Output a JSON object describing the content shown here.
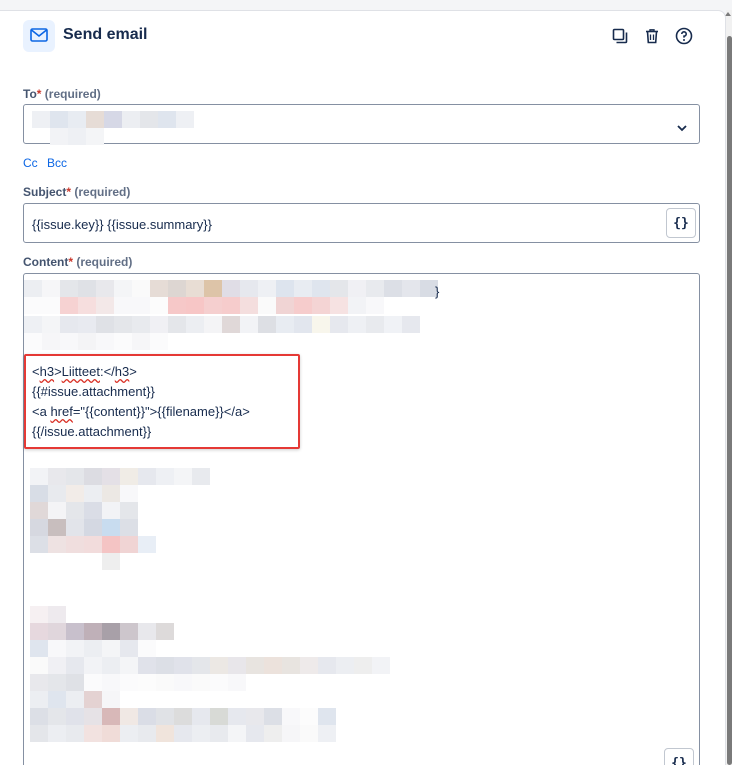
{
  "header": {
    "title": "Send email",
    "icons": [
      "envelope-icon",
      "duplicate-icon",
      "trash-icon",
      "help-icon"
    ]
  },
  "to": {
    "label": "To",
    "required_star": "*",
    "required_text": "(required)"
  },
  "cc_bcc": {
    "cc": "Cc",
    "bcc": "Bcc"
  },
  "subject": {
    "label": "Subject",
    "required_star": "*",
    "required_text": "(required)",
    "value": "{{issue.key}} {{issue.summary}}",
    "smart_value_button": "{}"
  },
  "content": {
    "label": "Content",
    "required_star": "*",
    "required_text": "(required)",
    "closing_brace": "}",
    "smart_value_button": "{}",
    "code": {
      "line1_open": "<",
      "line1_tag": "h3",
      "line1_gt": ">",
      "line1_word": "Liitteet",
      "line1_colon": ":</",
      "line1_tag_close": "h3",
      "line1_end": ">",
      "line2": "{{#issue.attachment}}",
      "line3_prefix": "<a ",
      "line3_attr": "href",
      "line3_rest": "=\"{{content}}\">{{filename}}</a>",
      "line4": "{{/issue.attachment}}"
    }
  },
  "colors": {
    "accent": "#0c66e4",
    "required": "#c9372c",
    "highlight": "#e53935",
    "text": "#172b4d"
  }
}
